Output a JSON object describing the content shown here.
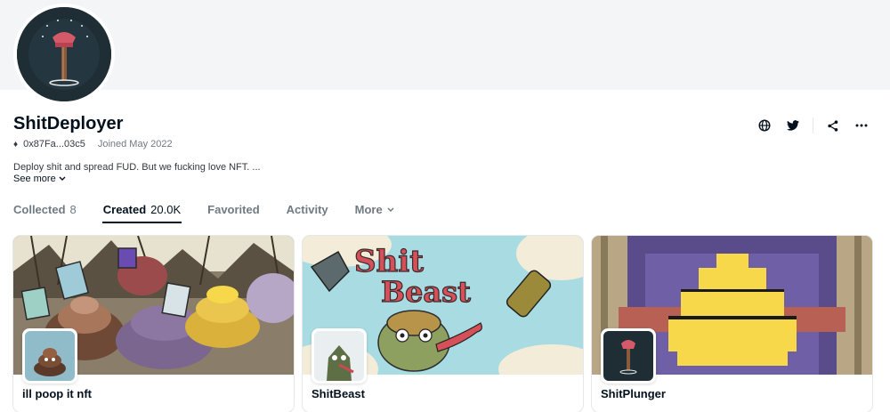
{
  "profile": {
    "name": "ShitDeployer",
    "address": "0x87Fa...03c5",
    "joined": "Joined May 2022",
    "bio": "Deploy shit and spread FUD. But we fucking love NFT. ...",
    "see_more": "See more"
  },
  "actions": [
    {
      "icon": "globe-icon"
    },
    {
      "icon": "twitter-icon"
    },
    {
      "icon": "share-icon"
    },
    {
      "icon": "more-icon"
    }
  ],
  "tabs": [
    {
      "label": "Collected",
      "count": "8",
      "active": false
    },
    {
      "label": "Created",
      "count": "20.0K",
      "active": true
    },
    {
      "label": "Favorited",
      "count": "",
      "active": false
    },
    {
      "label": "Activity",
      "count": "",
      "active": false
    },
    {
      "label": "More",
      "count": "",
      "active": false
    }
  ],
  "collections": [
    {
      "title": "ill poop it nft"
    },
    {
      "title": "ShitBeast"
    },
    {
      "title": "ShitPlunger"
    }
  ],
  "colors": {
    "text_primary": "#04111d",
    "text_secondary": "#707a83",
    "banner_bg": "#f4f5f7",
    "poop_yellow": "#f6d84a",
    "beast_sky": "#a9dbe3",
    "plunger_purple": "#5a4b8a"
  }
}
